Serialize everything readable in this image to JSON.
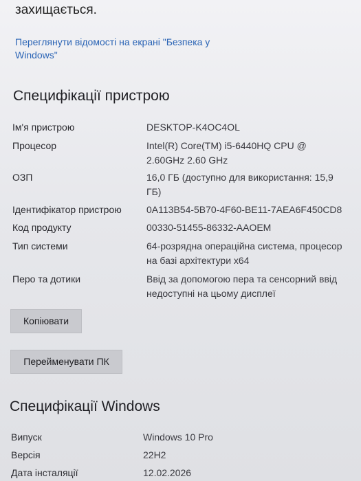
{
  "header": {
    "protected_text": "захищається.",
    "security_link": "Переглянути відомості на екрані \"Безпека у Windows\""
  },
  "device_specs": {
    "title": "Специфікації пристрою",
    "rows": [
      {
        "label": "Ім'я пристрою",
        "value": "DESKTOP-K4OC4OL"
      },
      {
        "label": "Процесор",
        "value": "Intel(R) Core(TM) i5-6440HQ CPU @ 2.60GHz   2.60 GHz"
      },
      {
        "label": "ОЗП",
        "value": "16,0 ГБ (доступно для використання: 15,9 ГБ)"
      },
      {
        "label": "Ідентифікатор пристрою",
        "value": "0A113B54-5B70-4F60-BE11-7AEA6F450CD8"
      },
      {
        "label": "Код продукту",
        "value": "00330-51455-86332-AAOEM"
      },
      {
        "label": "Тип системи",
        "value": "64-розрядна операційна система, процесор на базі архітектури x64"
      },
      {
        "label": "Перо та дотики",
        "value": "Ввід за допомогою пера та сенсорний ввід недоступні на цьому дисплеї"
      }
    ],
    "copy_button": "Копіювати",
    "rename_button": "Перейменувати ПК"
  },
  "windows_specs": {
    "title": "Специфікації Windows",
    "rows": [
      {
        "label": "Випуск",
        "value": "Windows 10 Pro"
      },
      {
        "label": "Версія",
        "value": "22H2"
      },
      {
        "label": "Дата інсталяції",
        "value": "12.02.2026"
      }
    ]
  }
}
